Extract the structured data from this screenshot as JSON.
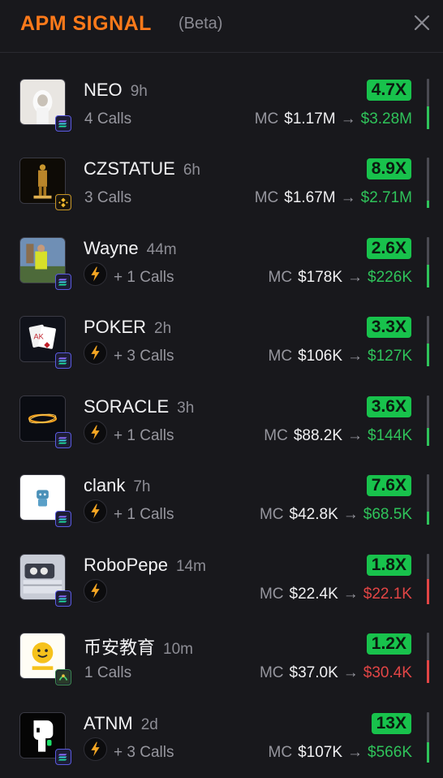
{
  "header": {
    "logo": "APM SIGNAL",
    "beta": "(Beta)"
  },
  "colors": {
    "accent": "#ff7a1a",
    "up": "#2fc35a",
    "down": "#e24545",
    "badge": "#18c24c"
  },
  "signals": [
    {
      "name": "NEO",
      "age": "9h",
      "calls": "4 Calls",
      "caller_icon": false,
      "mc_label": "MC",
      "from": "$1.17M",
      "to": "$3.28M",
      "direction": "up",
      "multiplier": "4.7X",
      "chain": "solana"
    },
    {
      "name": "CZSTATUE",
      "age": "6h",
      "calls": "3 Calls",
      "caller_icon": false,
      "mc_label": "MC",
      "from": "$1.67M",
      "to": "$2.71M",
      "direction": "up",
      "multiplier": "8.9X",
      "chain": "bnb"
    },
    {
      "name": "Wayne",
      "age": "44m",
      "calls": "+ 1 Calls",
      "caller_icon": true,
      "mc_label": "MC",
      "from": "$178K",
      "to": "$226K",
      "direction": "up",
      "multiplier": "2.6X",
      "chain": "solana"
    },
    {
      "name": "POKER",
      "age": "2h",
      "calls": "+ 3 Calls",
      "caller_icon": true,
      "mc_label": "MC",
      "from": "$106K",
      "to": "$127K",
      "direction": "up",
      "multiplier": "3.3X",
      "chain": "solana"
    },
    {
      "name": "SORACLE",
      "age": "3h",
      "calls": "+ 1 Calls",
      "caller_icon": true,
      "mc_label": "MC",
      "from": "$88.2K",
      "to": "$144K",
      "direction": "up",
      "multiplier": "3.6X",
      "chain": "solana"
    },
    {
      "name": "clank",
      "age": "7h",
      "calls": "+ 1 Calls",
      "caller_icon": true,
      "mc_label": "MC",
      "from": "$42.8K",
      "to": "$68.5K",
      "direction": "up",
      "multiplier": "7.6X",
      "chain": "solana"
    },
    {
      "name": "RoboPepe",
      "age": "14m",
      "calls": "",
      "caller_icon": true,
      "mc_label": "MC",
      "from": "$22.4K",
      "to": "$22.1K",
      "direction": "down",
      "multiplier": "1.8X",
      "chain": "solana"
    },
    {
      "name": "币安教育",
      "age": "10m",
      "calls": "1 Calls",
      "caller_icon": false,
      "mc_label": "MC",
      "from": "$37.0K",
      "to": "$30.4K",
      "direction": "down",
      "multiplier": "1.2X",
      "chain": "other"
    },
    {
      "name": "ATNM",
      "age": "2d",
      "calls": "+ 3 Calls",
      "caller_icon": true,
      "mc_label": "MC",
      "from": "$107K",
      "to": "$566K",
      "direction": "up",
      "multiplier": "13X",
      "chain": "solana"
    }
  ],
  "bar_levels": [
    0.45,
    0.15,
    0.45,
    0.45,
    0.35,
    0.25,
    0.5,
    0.45,
    0.4
  ]
}
